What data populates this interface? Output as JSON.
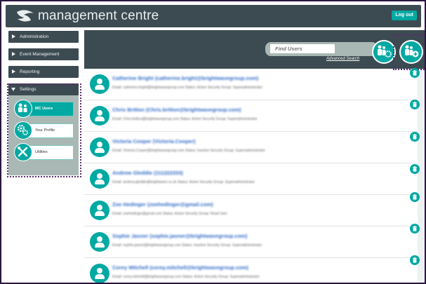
{
  "header": {
    "brand": "management centre",
    "logout_label": "Log out"
  },
  "sidebar": {
    "items": [
      {
        "label": "Administration"
      },
      {
        "label": "Event Management"
      },
      {
        "label": "Reporting"
      },
      {
        "label": "Settings"
      }
    ],
    "settings_sub": [
      {
        "label": "MC Users",
        "icon": "users-icon"
      },
      {
        "label": "Your Profile",
        "icon": "gears-icon"
      },
      {
        "label": "Utilities",
        "icon": "tools-icon"
      }
    ]
  },
  "search": {
    "placeholder": "Find Users",
    "advanced_label": "Advanced Search"
  },
  "users": [
    {
      "name": "Catherine Bright (catherine.bright@brightwavegroup.com)",
      "detail": "Email: catherine.bright@brightwavegroup.com   Status: Active   Security Group: Superadministrator"
    },
    {
      "name": "Chris Britton (Chris.britton@brightwavegroup.com)",
      "detail": "Email: Chris.britton@brightwavegroup.com   Status: Active   Security Group: Superadministrator"
    },
    {
      "name": "Victoria Cooper (Victoria.Cooper)",
      "detail": "Email: Victoria.Cooper@brightwavegroup.com   Status: Inactive   Security Group: Superadministrator"
    },
    {
      "name": "Andrew Gleddie (111222333)",
      "detail": "Email: andrew.gleddie@brightwave.co.uk   Status: Active   Security Group: Superadministrator"
    },
    {
      "name": "Zoe Hedinger (zoehedinger@gmail.com)",
      "detail": "Email: zoehedinger@gmail.com   Status: Active   Security Group: Read User"
    },
    {
      "name": "Sophie Jasner (sophie.jasner@brightwavegroup.com)",
      "detail": "Email: sophie.jasner@brightwavegroup.com   Status: Inactive   Security Group: Superadministrator"
    },
    {
      "name": "Corey Mitchell (corey.mitchell@brightwavegroup.com)",
      "detail": "Email: corey.mitchell@brightwavegroup.com   Status: Active   Security Group: Superadministrator"
    }
  ]
}
